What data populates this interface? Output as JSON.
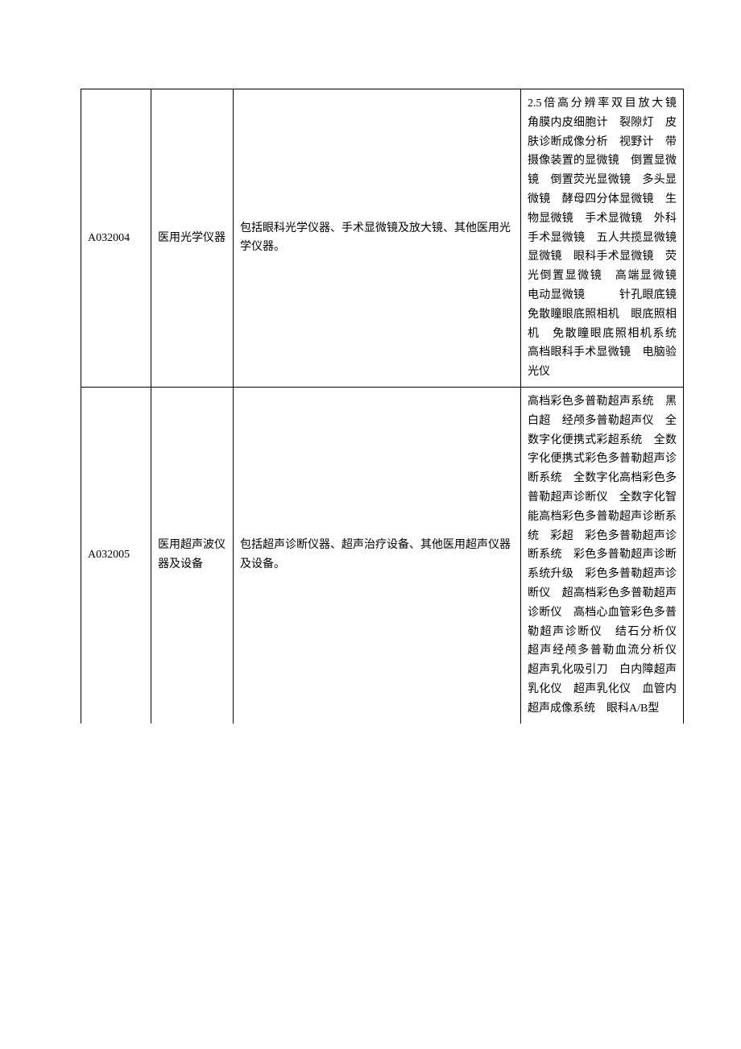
{
  "rows": [
    {
      "code": "A032004",
      "name": "医用光学仪器",
      "desc": "包括眼科光学仪器、手术显微镜及放大镜、其他医用光学仪器。",
      "examples": "2.5倍高分辨率双目放大镜　角膜内皮细胞计　裂隙灯　皮肤诊断成像分析　视野计　带摄像装置的显微镜　倒置显微镜　倒置荧光显微镜　多头显微镜　酵母四分体显微镜　生物显微镜　手术显微镜　外科手术显微镜　五人共揽显微镜　显微镜　眼科手术显微镜　荧光倒置显微镜　高端显微镜　电动显微镜　　　针孔眼底镜　免散瞳眼底照相机　眼底照相机　免散瞳眼底照相机系统　高档眼科手术显微镜　电脑验光仪"
    },
    {
      "code": "A032005",
      "name": "医用超声波仪器及设备",
      "desc": "包括超声诊断仪器、超声治疗设备、其他医用超声仪器及设备。",
      "examples": "高档彩色多普勒超声系统　黑白超　经颅多普勒超声仪　全数字化便携式彩超系统　全数字化便携式彩色多普勒超声诊断系统　全数字化高档彩色多普勒超声诊断仪　全数字化智能高档彩色多普勒超声诊断系统　彩超　彩色多普勒超声诊断系统　彩色多普勒超声诊断系统升级　彩色多普勒超声诊断仪　超高档彩色多普勒超声诊断仪　高档心血管彩色多普勒超声诊断仪　结石分析仪　超声经颅多普勒血流分析仪　超声乳化吸引刀　白内障超声乳化仪　超声乳化仪　血管内超声成像系统　眼科A/B型"
    }
  ]
}
